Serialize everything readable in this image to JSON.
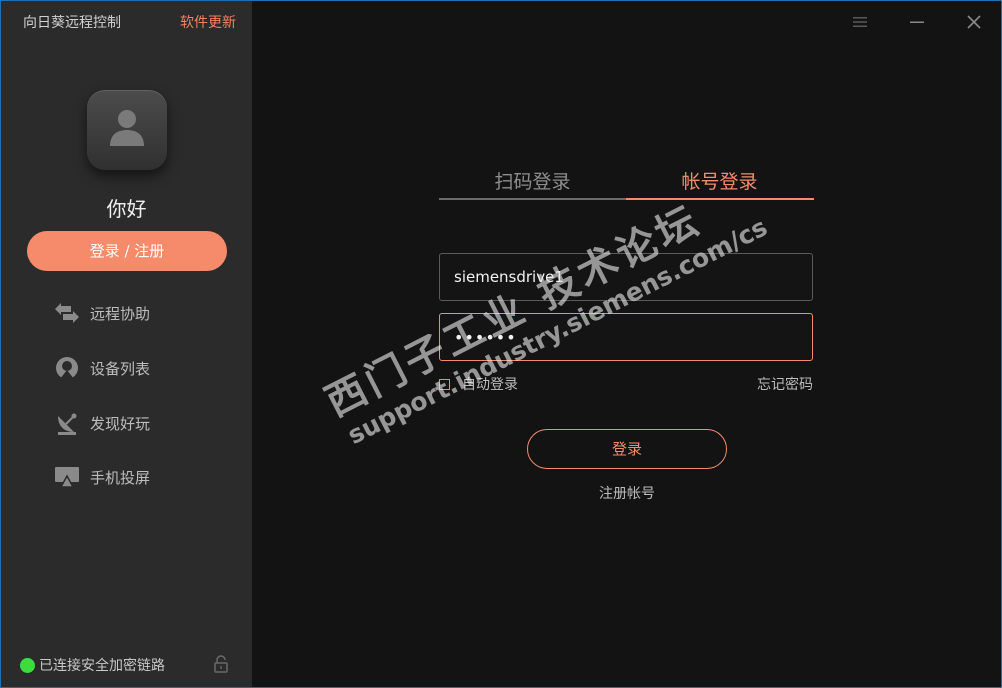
{
  "app": {
    "title": "向日葵远程控制",
    "update_label": "软件更新"
  },
  "sidebar": {
    "greeting": "你好",
    "login_register_label": "登录 / 注册",
    "items": [
      {
        "label": "远程协助",
        "icon": "remote-assist-icon"
      },
      {
        "label": "设备列表",
        "icon": "device-list-icon"
      },
      {
        "label": "发现好玩",
        "icon": "discover-icon"
      },
      {
        "label": "手机投屏",
        "icon": "screen-mirror-icon"
      }
    ],
    "connection_status": "已连接安全加密链路"
  },
  "login": {
    "tabs": [
      {
        "label": "扫码登录",
        "active": false
      },
      {
        "label": "帐号登录",
        "active": true
      }
    ],
    "username_value": "siemensdrive1",
    "password_value": "••••••",
    "remember_label": "自动登录",
    "forgot_label": "忘记密码",
    "submit_label": "登录",
    "register_label": "注册帐号"
  },
  "watermark": {
    "line1": "西门子工业 技术论坛",
    "line2": "support.industry.siemens.com/cs"
  },
  "colors": {
    "accent": "#f58b6b",
    "sidebar_bg": "#2b2b2b",
    "main_bg": "#131313",
    "status_ok": "#3ddc3d"
  }
}
